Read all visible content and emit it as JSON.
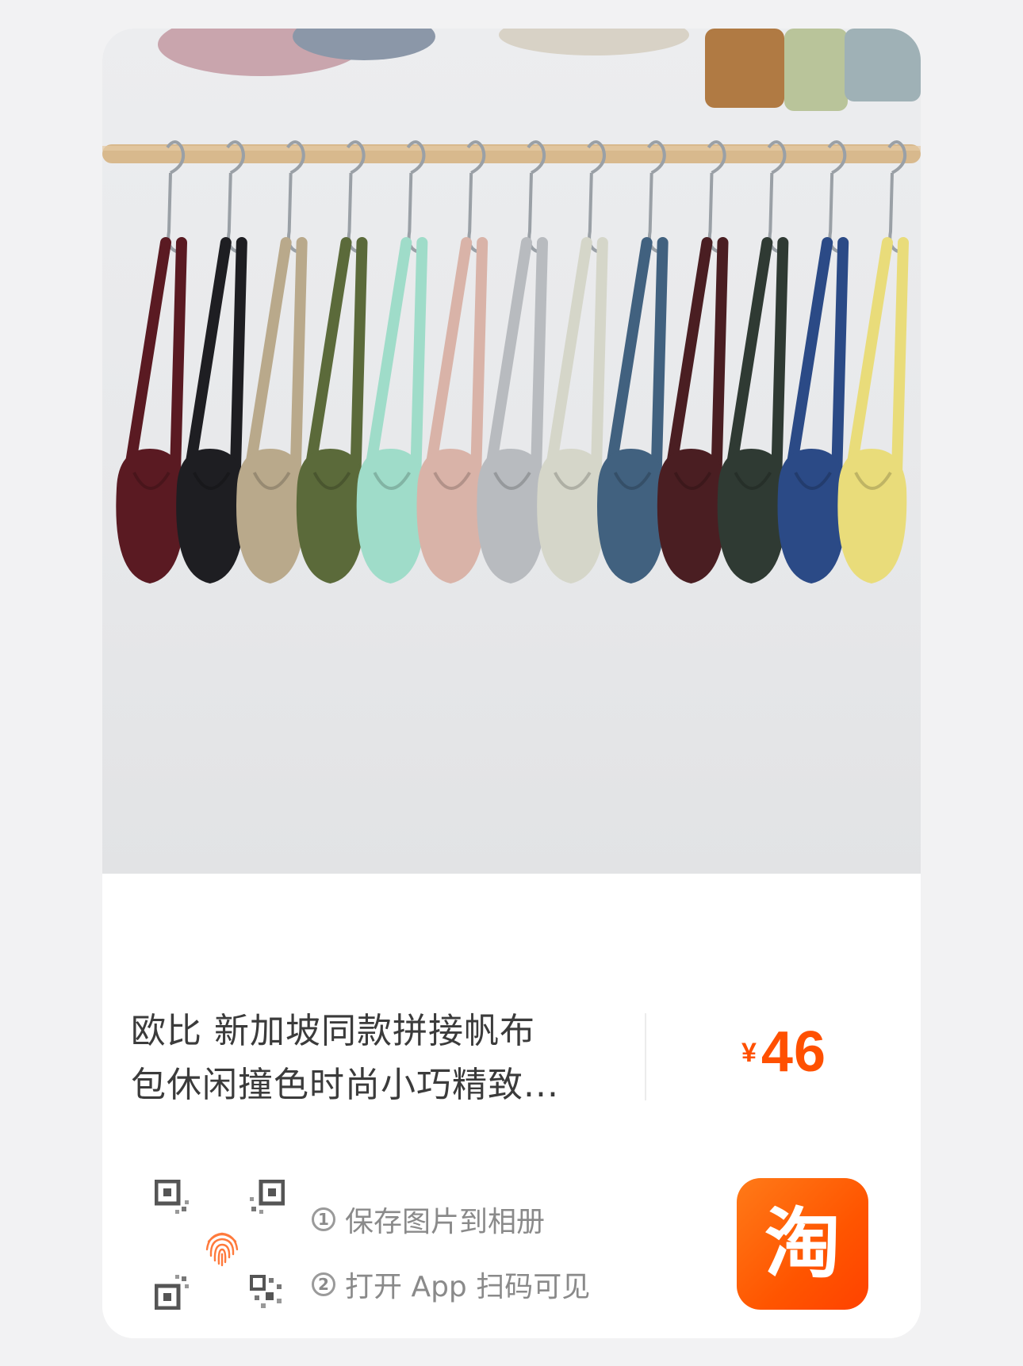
{
  "product": {
    "title_line1": "欧比 新加坡同款拼接帆布",
    "title_line2": "包休闲撞色时尚小巧精致...",
    "currency": "¥",
    "price": "46"
  },
  "instructions": {
    "step1_num": "1",
    "step1": "保存图片到相册",
    "step2_num": "2",
    "step2": "打开 App 扫码可见"
  },
  "app": {
    "logo_char": "淘",
    "brand_color": "#ff5000"
  },
  "bag_colors": [
    "#5a1a22",
    "#1e1e22",
    "#b9a98b",
    "#5b6a3a",
    "#9fdcc9",
    "#d9b3a8",
    "#b8bbbf",
    "#d5d6c9",
    "#41617f",
    "#4a1e22",
    "#2f3a33",
    "#2b4a86",
    "#e9dc7a"
  ]
}
